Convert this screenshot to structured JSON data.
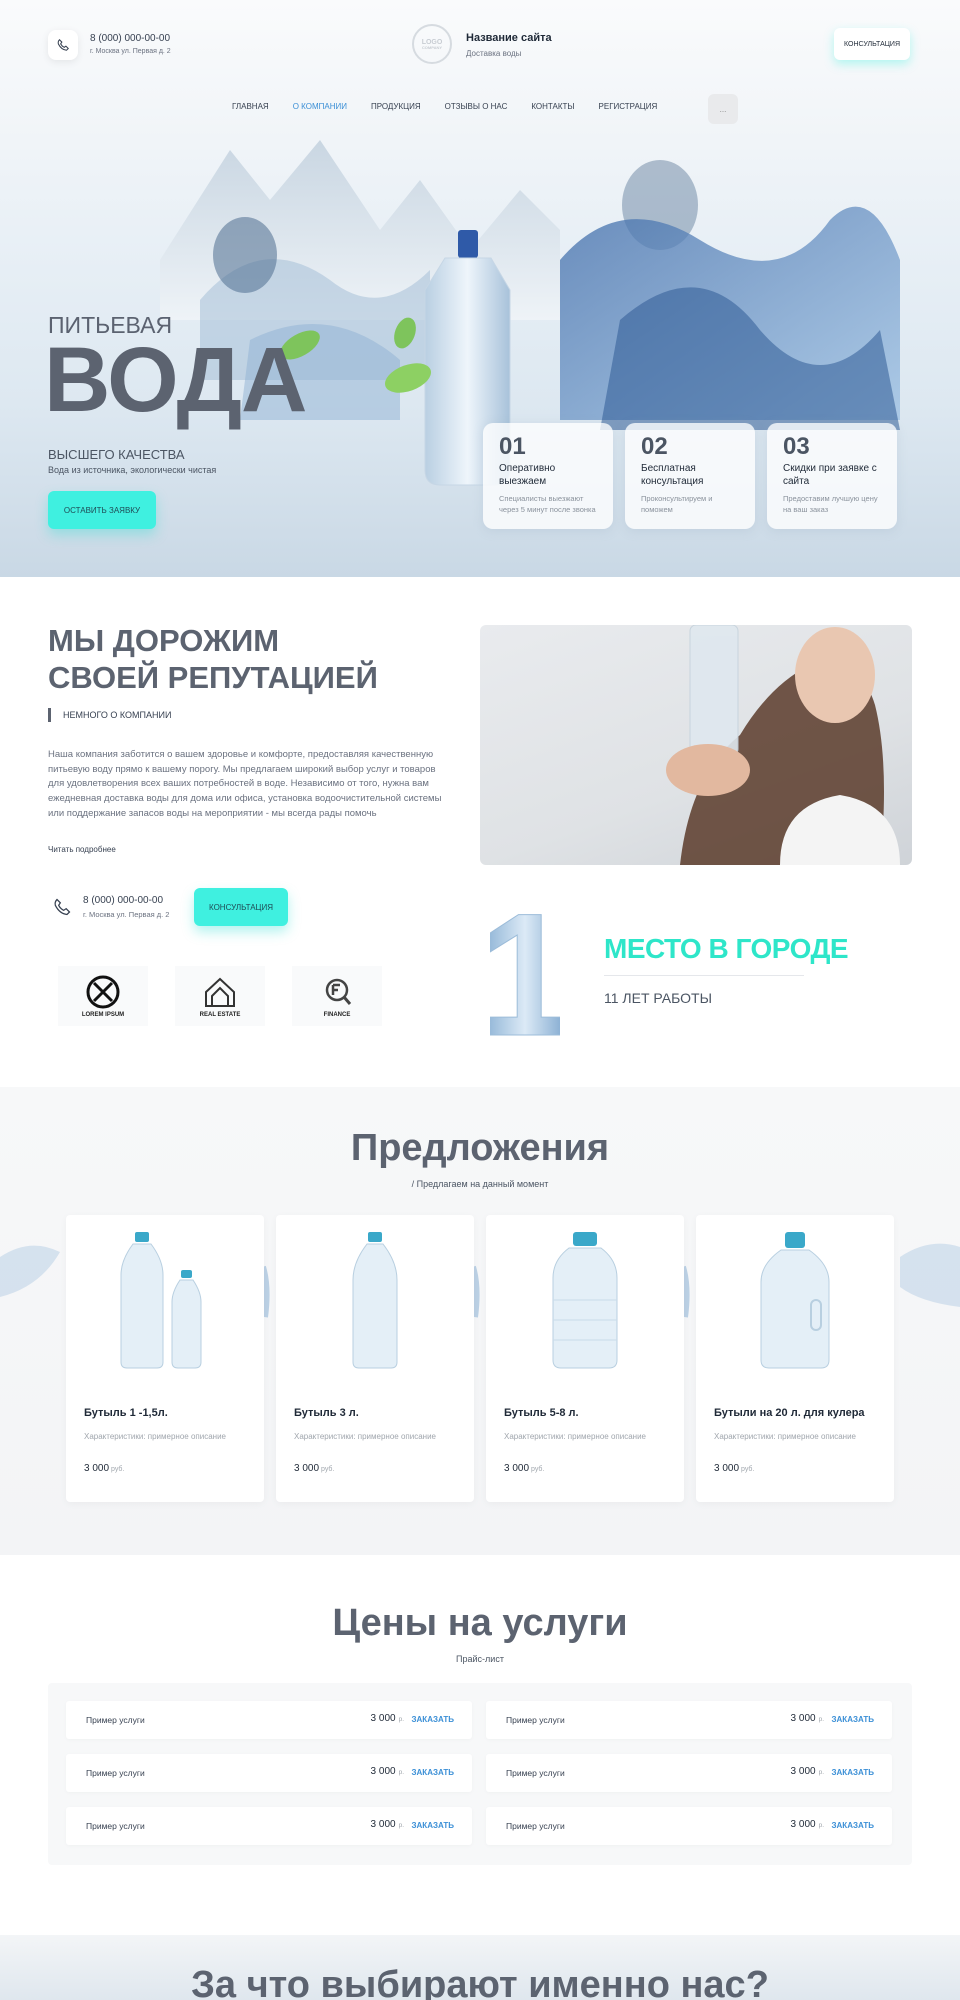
{
  "header": {
    "phone": "8 (000) 000-00-00",
    "address": "г. Москва ул. Первая д. 2",
    "logo_text": "LOGO",
    "logo_sub": "COMPANY",
    "site_name": "Название сайта",
    "site_sub": "Доставка воды",
    "consult_button": "КОНСУЛЬТАЦИЯ"
  },
  "nav": {
    "items": [
      "ГЛАВНАЯ",
      "О КОМПАНИИ",
      "ПРОДУКЦИЯ",
      "ОТЗЫВЫ О НАС",
      "КОНТАКТЫ",
      "РЕГИСТРАЦИЯ"
    ],
    "active_index": 1,
    "menu_button": "..."
  },
  "hero": {
    "pre_title": "ПИТЬЕВАЯ",
    "title": "ВОДА",
    "subtitle": "ВЫСШЕГО КАЧЕСТВА",
    "description": "Вода из источника, экологически чистая",
    "cta": "ОСТАВИТЬ ЗАЯВКУ",
    "features": [
      {
        "num": "01",
        "title": "Оперативно выезжаем",
        "text": "Специалисты выезжают через 5 минут после звонка"
      },
      {
        "num": "02",
        "title": "Бесплатная консультация",
        "text": "Проконсультируем и поможем"
      },
      {
        "num": "03",
        "title": "Скидки при заявке с сайта",
        "text": "Предоставим лучшую цену на ваш заказ"
      }
    ]
  },
  "about": {
    "title": "МЫ ДОРОЖИМ СВОЕЙ РЕПУТАЦИЕЙ",
    "tag": "НЕМНОГО О КОМПАНИИ",
    "text": "Наша компания заботится о вашем здоровье и комфорте, предоставляя качественную питьевую воду прямо к вашему порогу. Мы предлагаем широкий выбор услуг и товаров для удовлетворения всех ваших потребностей в воде. Независимо от того, нужна вам ежедневная доставка воды для дома или офиса, установка водоочистительной системы или поддержание запасов воды на мероприятии - мы всегда рады помочь",
    "more_link": "Читать подробнее",
    "phone": "8 (000) 000-00-00",
    "address": "г. Москва ул. Первая д. 2",
    "consult_button": "КОНСУЛЬТАЦИЯ",
    "partners": [
      {
        "label": "LOREM IPSUM"
      },
      {
        "label": "REAL ESTATE"
      },
      {
        "label": "FINANCE"
      }
    ],
    "place_number": "1",
    "place_title": "МЕСТО В ГОРОДЕ",
    "place_sub": "11 ЛЕТ РАБОТЫ"
  },
  "offers": {
    "title": "Предложения",
    "subtitle": "/ Предлагаем на данный момент",
    "items": [
      {
        "name": "Бутыль 1 -1,5л.",
        "desc": "Характеристики: примерное описание",
        "price": "3 000",
        "currency": "руб."
      },
      {
        "name": "Бутыль 3 л.",
        "desc": "Характеристики: примерное описание",
        "price": "3 000",
        "currency": "руб."
      },
      {
        "name": "Бутыль 5-8 л.",
        "desc": "Характеристики: примерное описание",
        "price": "3 000",
        "currency": "руб."
      },
      {
        "name": "Бутыли на 20 л. для кулера",
        "desc": "Характеристики: примерное описание",
        "price": "3 000",
        "currency": "руб."
      }
    ]
  },
  "prices": {
    "title": "Цены на услуги",
    "subtitle": "Прайс-лист",
    "rows": [
      {
        "name": "Пример услуги",
        "price": "3 000",
        "currency": "р.",
        "order": "ЗАКАЗАТЬ"
      },
      {
        "name": "Пример услуги",
        "price": "3 000",
        "currency": "р.",
        "order": "ЗАКАЗАТЬ"
      },
      {
        "name": "Пример услуги",
        "price": "3 000",
        "currency": "р.",
        "order": "ЗАКАЗАТЬ"
      },
      {
        "name": "Пример услуги",
        "price": "3 000",
        "currency": "р.",
        "order": "ЗАКАЗАТЬ"
      },
      {
        "name": "Пример услуги",
        "price": "3 000",
        "currency": "р.",
        "order": "ЗАКАЗАТЬ"
      },
      {
        "name": "Пример услуги",
        "price": "3 000",
        "currency": "р.",
        "order": "ЗАКАЗАТЬ"
      }
    ]
  },
  "why": {
    "title": "За что выбирают именно нас?"
  },
  "colors": {
    "accent": "#3ff0e0",
    "heading": "#5c6370",
    "link": "#3b8fd6",
    "place_title": "#2ee6c9"
  }
}
